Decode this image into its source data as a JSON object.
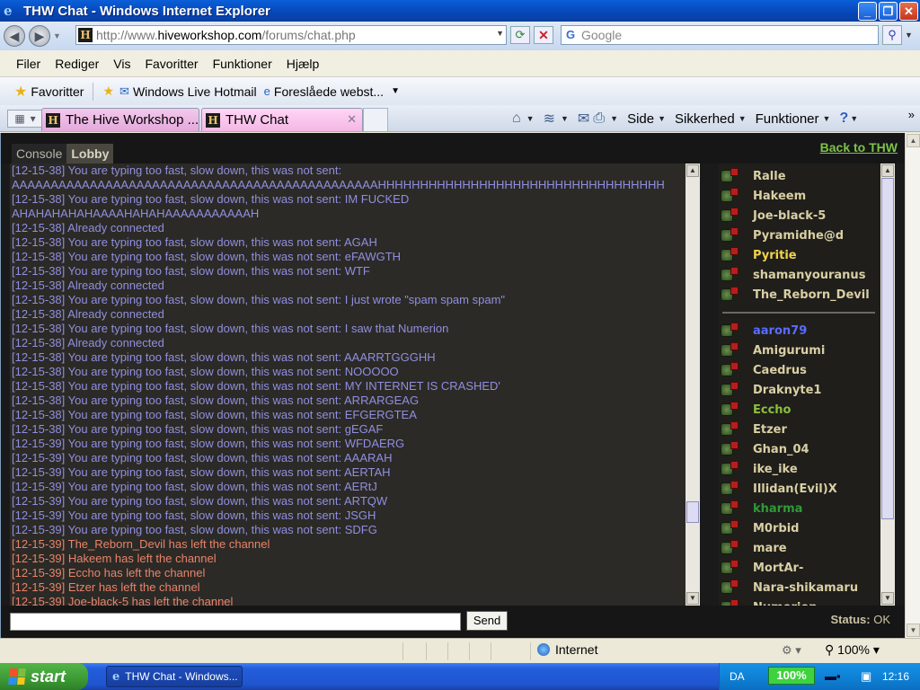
{
  "window": {
    "title": "THW Chat - Windows Internet Explorer"
  },
  "addressbar": {
    "url_prefix": "http://www.",
    "url_domain": "hiveworkshop.com",
    "url_path": "/forums/chat.php",
    "search_placeholder": "Google"
  },
  "menu": [
    "Filer",
    "Rediger",
    "Vis",
    "Favoritter",
    "Funktioner",
    "Hjælp"
  ],
  "favorites": {
    "label": "Favoritter",
    "links": [
      "Windows Live Hotmail",
      "Foreslåede webst..."
    ]
  },
  "tabs": [
    {
      "label": "The Hive Workshop ..."
    },
    {
      "label": "THW Chat"
    }
  ],
  "commandbar": {
    "side": "Side",
    "security": "Sikkerhed",
    "tools": "Funktioner"
  },
  "chat": {
    "tab_console": "Console",
    "tab_lobby": "Lobby",
    "back_link": "Back to THW",
    "lines": [
      {
        "text": "[12-15-38] You are typing too fast, slow down, this was not sent:",
        "kind": "sys"
      },
      {
        "text": "AAAAAAAAAAAAAAAAAAAAAAAAAAAAAAAAAAAAAAAAAAAAAAAHHHHHHHHHHHHHHHHHHHHHHHHHHHHHHHHHH",
        "kind": "sys"
      },
      {
        "text": "[12-15-38] You are typing too fast, slow down, this was not sent: IM FUCKED",
        "kind": "sys"
      },
      {
        "text": "AHAHAHAHAHAAAAHAHAHAAAAAAAAAAAH",
        "kind": "sys"
      },
      {
        "text": "[12-15-38] Already connected",
        "kind": "sys"
      },
      {
        "text": "[12-15-38] You are typing too fast, slow down, this was not sent: AGAH",
        "kind": "sys"
      },
      {
        "text": "[12-15-38] You are typing too fast, slow down, this was not sent: eFAWGTH",
        "kind": "sys"
      },
      {
        "text": "[12-15-38] You are typing too fast, slow down, this was not sent: WTF",
        "kind": "sys"
      },
      {
        "text": "[12-15-38] Already connected",
        "kind": "sys"
      },
      {
        "text": "[12-15-38] You are typing too fast, slow down, this was not sent: I just wrote \"spam spam spam\"",
        "kind": "sys"
      },
      {
        "text": "[12-15-38] Already connected",
        "kind": "sys"
      },
      {
        "text": "[12-15-38] You are typing too fast, slow down, this was not sent: I saw that Numerion",
        "kind": "sys"
      },
      {
        "text": "[12-15-38] Already connected",
        "kind": "sys"
      },
      {
        "text": "[12-15-38] You are typing too fast, slow down, this was not sent: AAARRTGGGHH",
        "kind": "sys"
      },
      {
        "text": "[12-15-38] You are typing too fast, slow down, this was not sent: NOOOOO",
        "kind": "sys"
      },
      {
        "text": "[12-15-38] You are typing too fast, slow down, this was not sent: MY INTERNET IS CRASHED'",
        "kind": "sys"
      },
      {
        "text": "[12-15-38] You are typing too fast, slow down, this was not sent: ARRARGEAG",
        "kind": "sys"
      },
      {
        "text": "[12-15-38] You are typing too fast, slow down, this was not sent: EFGERGTEA",
        "kind": "sys"
      },
      {
        "text": "[12-15-38] You are typing too fast, slow down, this was not sent: gEGAF",
        "kind": "sys"
      },
      {
        "text": "[12-15-39] You are typing too fast, slow down, this was not sent: WFDAERG",
        "kind": "sys"
      },
      {
        "text": "[12-15-39] You are typing too fast, slow down, this was not sent: AAARAH",
        "kind": "sys"
      },
      {
        "text": "[12-15-39] You are typing too fast, slow down, this was not sent: AERTAH",
        "kind": "sys"
      },
      {
        "text": "[12-15-39] You are typing too fast, slow down, this was not sent: AERtJ",
        "kind": "sys"
      },
      {
        "text": "[12-15-39] You are typing too fast, slow down, this was not sent: ARTQW",
        "kind": "sys"
      },
      {
        "text": "[12-15-39] You are typing too fast, slow down, this was not sent: JSGH",
        "kind": "sys"
      },
      {
        "text": "[12-15-39] You are typing too fast, slow down, this was not sent: SDFG",
        "kind": "sys"
      },
      {
        "text": "[12-15-39]  The_Reborn_Devil has left the channel",
        "kind": "leave"
      },
      {
        "text": "[12-15-39]  Hakeem has left the channel",
        "kind": "leave"
      },
      {
        "text": "[12-15-39]  Eccho has left the channel",
        "kind": "leave"
      },
      {
        "text": "[12-15-39]  Etzer has left the channel",
        "kind": "leave"
      },
      {
        "text": "[12-15-39]  Joe-black-5 has left the channel",
        "kind": "leave"
      }
    ],
    "users_top": [
      {
        "name": "Ralle",
        "style": "admin"
      },
      {
        "name": "Hakeem",
        "style": "admin"
      },
      {
        "name": "Joe-black-5",
        "style": "admin"
      },
      {
        "name": "Pyramidhe@d",
        "style": "admin"
      },
      {
        "name": "Pyritie",
        "style": "gold"
      },
      {
        "name": "shamanyouranus",
        "style": "admin"
      },
      {
        "name": "The_Reborn_Devil",
        "style": "admin"
      }
    ],
    "users_bottom": [
      {
        "name": "aaron79",
        "style": "blue"
      },
      {
        "name": "Amigurumi",
        "style": "admin"
      },
      {
        "name": "Caedrus",
        "style": "admin"
      },
      {
        "name": "Draknyte1",
        "style": "admin"
      },
      {
        "name": "Eccho",
        "style": "green"
      },
      {
        "name": "Etzer",
        "style": "admin"
      },
      {
        "name": "Ghan_04",
        "style": "admin"
      },
      {
        "name": "ike_ike",
        "style": "admin"
      },
      {
        "name": "Illidan(Evil)X",
        "style": "admin"
      },
      {
        "name": "kharma",
        "style": "dgreen"
      },
      {
        "name": "M0rbid",
        "style": "admin"
      },
      {
        "name": "mare",
        "style": "admin"
      },
      {
        "name": "MortAr-",
        "style": "admin"
      },
      {
        "name": "Nara-shikamaru",
        "style": "admin"
      },
      {
        "name": "Numerion",
        "style": "admin"
      }
    ],
    "send_label": "Send",
    "status_label": "Status:",
    "status_value": "OK"
  },
  "statusbar": {
    "zone": "Internet",
    "zoom": "100%"
  },
  "taskbar": {
    "start": "start",
    "task": "THW Chat - Windows...",
    "lang": "DA",
    "battery": "100%",
    "clock": "12:16"
  }
}
